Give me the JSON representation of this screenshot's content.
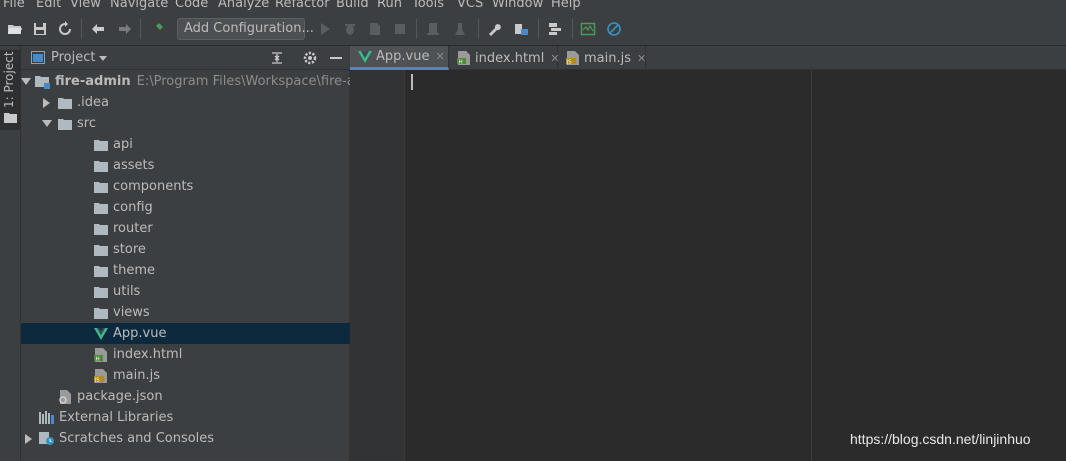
{
  "menu": [
    "File",
    "Edit",
    "View",
    "Navigate",
    "Code",
    "Analyze",
    "Refactor",
    "Build",
    "Run",
    "Tools",
    "VCS",
    "Window",
    "Help"
  ],
  "toolbar": {
    "run_config_label": "Add Configuration...",
    "icons": [
      "open-icon",
      "save-icon",
      "sync-icon",
      "back-icon",
      "forward-icon",
      "build-icon",
      "run-icon",
      "debug-icon",
      "coverage-icon",
      "stop-icon",
      "attach-icon",
      "profile-icon",
      "settings-wrench-icon",
      "project-structure-icon",
      "vcs-icon",
      "monitor-icon",
      "power-save-icon"
    ]
  },
  "side_tab": {
    "label": "1: Project"
  },
  "project_panel": {
    "title": "Project",
    "tree": [
      {
        "label": "fire-admin",
        "path": "E:\\Program Files\\Workspace\\fire-admin",
        "type": "module",
        "level": 0,
        "expanded": true,
        "bold": true
      },
      {
        "label": ".idea",
        "type": "folder",
        "level": 1,
        "expanded": false
      },
      {
        "label": "src",
        "type": "folder",
        "level": 1,
        "expanded": true
      },
      {
        "label": "api",
        "type": "folder",
        "level": 2
      },
      {
        "label": "assets",
        "type": "folder",
        "level": 2
      },
      {
        "label": "components",
        "type": "folder",
        "level": 2
      },
      {
        "label": "config",
        "type": "folder",
        "level": 2
      },
      {
        "label": "router",
        "type": "folder",
        "level": 2
      },
      {
        "label": "store",
        "type": "folder",
        "level": 2
      },
      {
        "label": "theme",
        "type": "folder",
        "level": 2
      },
      {
        "label": "utils",
        "type": "folder",
        "level": 2
      },
      {
        "label": "views",
        "type": "folder",
        "level": 2
      },
      {
        "label": "App.vue",
        "type": "vue",
        "level": 2,
        "selected": true
      },
      {
        "label": "index.html",
        "type": "html",
        "level": 2
      },
      {
        "label": "main.js",
        "type": "js",
        "level": 2
      },
      {
        "label": "package.json",
        "type": "json",
        "level": 1
      },
      {
        "label": "External Libraries",
        "type": "libraries",
        "level": 0
      },
      {
        "label": "Scratches and Consoles",
        "type": "scratches",
        "level": 0,
        "expanded": false
      }
    ]
  },
  "editor": {
    "tabs": [
      {
        "label": "App.vue",
        "type": "vue",
        "active": true
      },
      {
        "label": "index.html",
        "type": "html",
        "active": false
      },
      {
        "label": "main.js",
        "type": "js",
        "active": false
      }
    ]
  },
  "watermark": "https://blog.csdn.net/linjinhuo",
  "colors": {
    "accent": "#4a88c7",
    "vue_green": "#41b883",
    "selection": "#0d293e",
    "run_green": "#499c54"
  }
}
